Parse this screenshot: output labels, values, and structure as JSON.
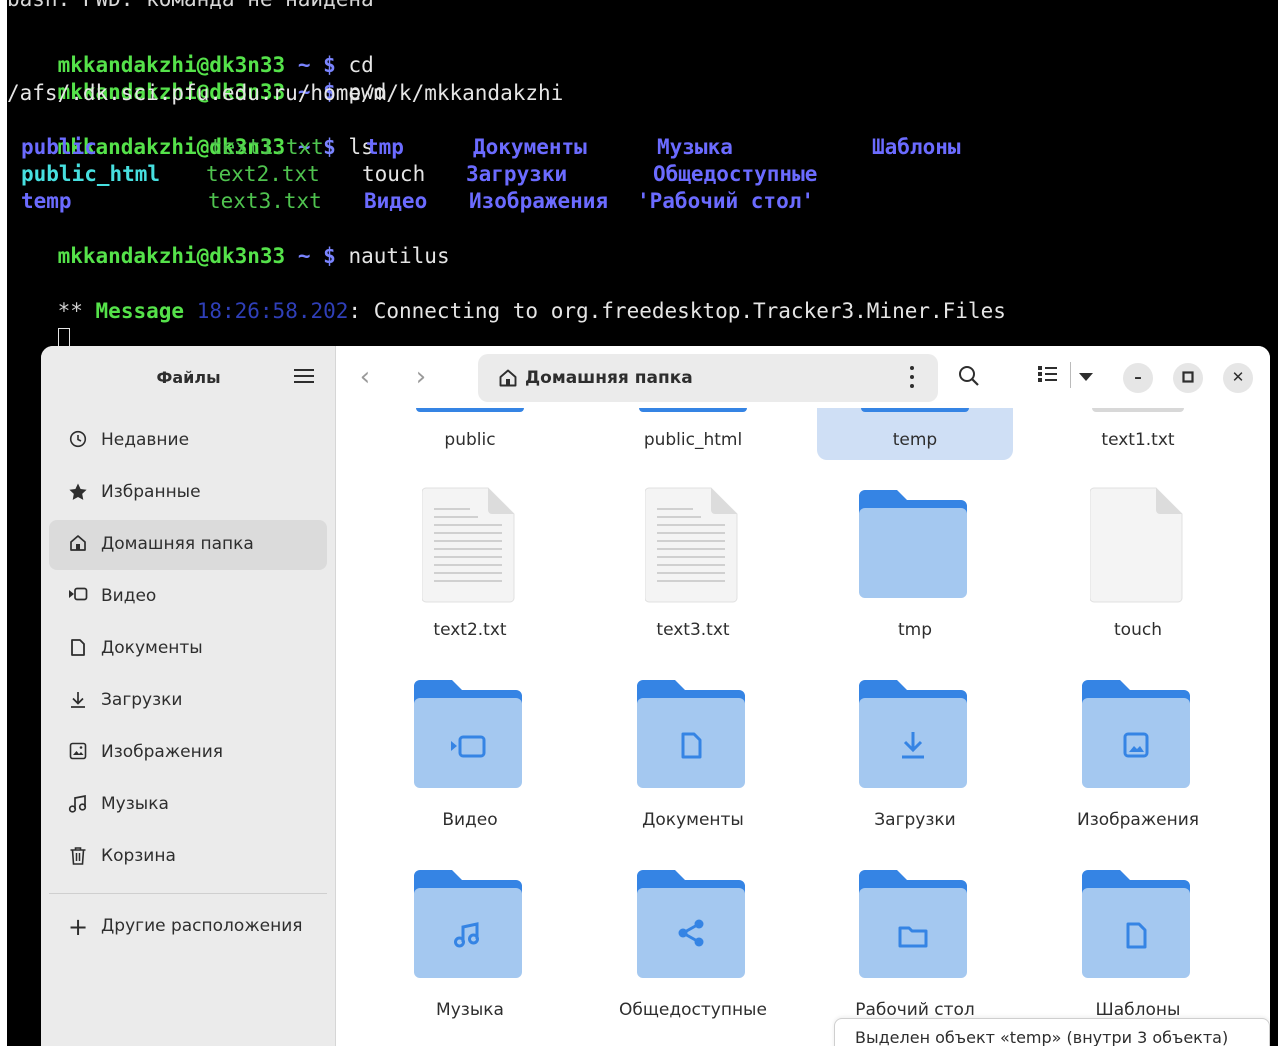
{
  "terminal": {
    "cut_line": "bash: PWD: команда не найдена",
    "prompt_user": "mkkandakzhi@dk3n33",
    "prompt_tilde": "~",
    "prompt_dollar": "$",
    "commands": [
      "cd",
      "pwd",
      "ls",
      "nautilus"
    ],
    "pwd_output": "/afs/.dk.sci.pfu.edu.ru/home/m/k/mkkandakzhi",
    "ls": {
      "row1": [
        "public",
        "text1.txt",
        "tmp",
        "Документы",
        "Музыка",
        "Шаблоны"
      ],
      "row2": [
        "public_html",
        "text2.txt",
        "touch",
        "Загрузки",
        "Общедоступные"
      ],
      "row3": [
        "temp",
        "text3.txt",
        "Видео",
        "Изображения",
        "'Рабочий стол'"
      ]
    },
    "message": {
      "stars": "**",
      "word": "Message",
      "time": "18:26:58.202",
      "text": ": Connecting to org.freedesktop.Tracker3.Miner.Files"
    }
  },
  "files": {
    "app_title": "Файлы",
    "path_label": "Домашняя папка",
    "sidebar": [
      {
        "label": "Недавние",
        "icon": "clock-icon"
      },
      {
        "label": "Избранные",
        "icon": "star-icon"
      },
      {
        "label": "Домашняя папка",
        "icon": "home-icon",
        "active": true
      },
      {
        "label": "Видео",
        "icon": "video-icon"
      },
      {
        "label": "Документы",
        "icon": "document-icon"
      },
      {
        "label": "Загрузки",
        "icon": "download-icon"
      },
      {
        "label": "Изображения",
        "icon": "image-icon"
      },
      {
        "label": "Музыка",
        "icon": "music-icon"
      },
      {
        "label": "Корзина",
        "icon": "trash-icon"
      }
    ],
    "other_locations": "Другие расположения",
    "top_row": [
      "public",
      "public_html",
      "temp",
      "text1.txt"
    ],
    "grid_row1": [
      "text2.txt",
      "text3.txt",
      "tmp",
      "touch"
    ],
    "grid_row2": [
      "Видео",
      "Документы",
      "Загрузки",
      "Изображения"
    ],
    "grid_row3": [
      "Музыка",
      "Общедоступные",
      "Рабочий стол",
      "Шаблоны"
    ],
    "status": "Выделен объект «temp» (внутри 3 объекта)"
  },
  "colors": {
    "folder_dark": "#3584e4",
    "folder_light": "#a4c8f0",
    "selection": "#cfdff5",
    "prompt_green": "#55e24a",
    "dir_blue": "#6b6bff"
  }
}
